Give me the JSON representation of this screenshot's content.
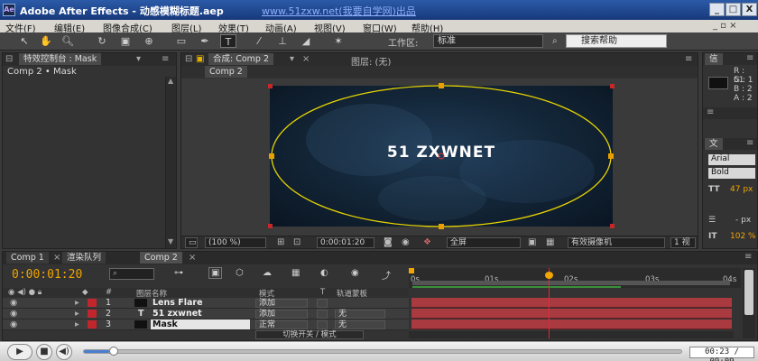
{
  "window": {
    "title": "Adobe After Effects - 动感模糊标题.aep",
    "watermark": "www.51zxw.net(我要自学网)出品",
    "min": "_",
    "max": "□",
    "close": "X"
  },
  "menu": [
    "文件(F)",
    "编辑(E)",
    "图像合成(C)",
    "图层(L)",
    "效果(T)",
    "动画(A)",
    "视图(V)",
    "窗口(W)",
    "帮助(H)"
  ],
  "toolbar": {
    "workspace_label": "工作区:",
    "workspace_value": "标准",
    "help_placeholder": "搜索帮助"
  },
  "effects_panel": {
    "tab": "特效控制台 : Mask",
    "breadcrumb": "Comp 2 • Mask"
  },
  "comp_panel": {
    "tab_comp": "合成: Comp 2",
    "tab_layer": "图层: (无)",
    "subtab": "Comp 2",
    "canvas_text": "51 ZXWNET",
    "zoom": "(100 %)",
    "timecode": "0:00:01:20",
    "resolution": "全屏",
    "camera": "有效摄像机",
    "views": "1 视"
  },
  "info_panel": {
    "tab": "信",
    "r": "R : 51",
    "g": "G : 1",
    "b": "B : 2",
    "a": "A : 2"
  },
  "char_panel": {
    "tab": "文",
    "font": "Arial",
    "style": "Bold",
    "size": "47 px",
    "leading": "- px",
    "scale": "102 %"
  },
  "timeline": {
    "tabs": [
      "Comp 1",
      "渲染队列",
      "Comp 2"
    ],
    "timecode": "0:00:01:20",
    "col_num": "#",
    "col_name": "图层名称",
    "col_mode": "模式",
    "col_t": "T",
    "col_track": "轨道蒙板",
    "footer": "切换开关 / 模式",
    "ruler": [
      "0s",
      "01s",
      "02s",
      "03s",
      "04s"
    ],
    "layers": [
      {
        "num": "1",
        "name": "Lens Flare",
        "mode": "添加",
        "track": "",
        "color": "#c0262c"
      },
      {
        "num": "2",
        "name": "51 zxwnet",
        "mode": "添加",
        "track": "无",
        "color": "#c0262c"
      },
      {
        "num": "3",
        "name": "Mask",
        "mode": "正常",
        "track": "无",
        "color": "#c0262c"
      }
    ],
    "playhead_fraction": 0.42
  },
  "player": {
    "time": "00:23 / 09:09",
    "progress": 0.042
  },
  "colors": {
    "accent_timecode": "#f0a500",
    "layer_bar": "#a83a40",
    "mask_ellipse": "#e8d400"
  }
}
